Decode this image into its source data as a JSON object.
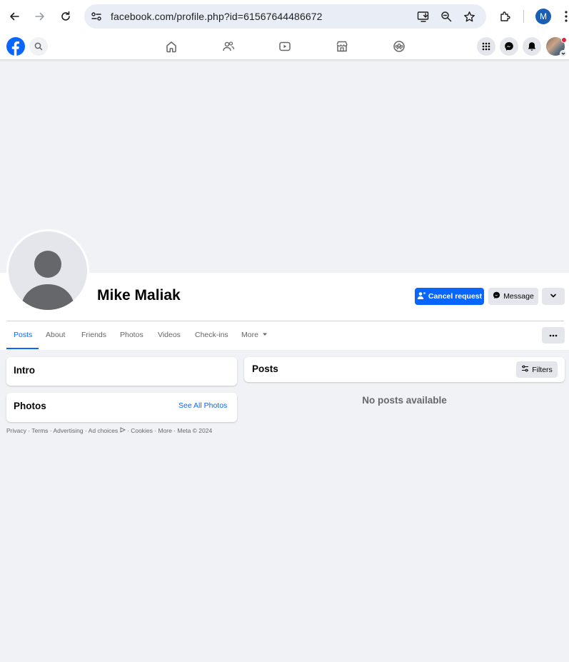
{
  "browser": {
    "url": "facebook.com/profile.php?id=61567644486672",
    "profile_initial": "M"
  },
  "profile": {
    "name": "Mike Maliak",
    "cancel_request_label": "Cancel request",
    "message_label": "Message"
  },
  "tabs": [
    {
      "label": "Posts",
      "active": true
    },
    {
      "label": "About"
    },
    {
      "label": "Friends"
    },
    {
      "label": "Photos"
    },
    {
      "label": "Videos"
    },
    {
      "label": "Check-ins"
    },
    {
      "label": "More"
    }
  ],
  "intro": {
    "title": "Intro"
  },
  "photos": {
    "title": "Photos",
    "see_all": "See All Photos"
  },
  "posts": {
    "title": "Posts",
    "filters_label": "Filters",
    "empty_text": "No posts available"
  },
  "footer": {
    "links": [
      "Privacy",
      "Terms",
      "Advertising",
      "Ad choices",
      "Cookies",
      "More",
      "Meta © 2024"
    ]
  },
  "colors": {
    "brand": "#0866ff",
    "background": "#f0f2f5",
    "notification": "#e41e3f"
  },
  "icons": [
    "back-icon",
    "forward-icon",
    "reload-icon",
    "site-info-icon",
    "install-icon",
    "zoom-icon",
    "star-icon",
    "extensions-icon",
    "more-vert-icon",
    "facebook-logo",
    "search-icon",
    "home-icon",
    "friends-icon",
    "watch-icon",
    "marketplace-icon",
    "groups-icon",
    "menu-grid-icon",
    "messenger-icon",
    "bell-icon",
    "add-friend-icon",
    "chevron-down-icon",
    "more-horiz-icon",
    "filters-icon",
    "ad-choices-icon"
  ]
}
